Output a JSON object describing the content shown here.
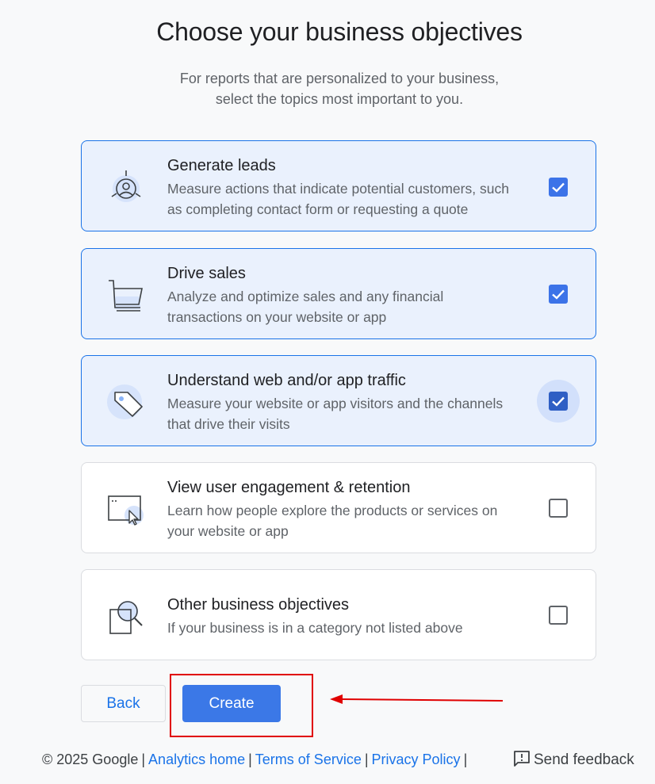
{
  "header": {
    "title": "Choose your business objectives",
    "subtitle_line1": "For reports that are personalized to your business,",
    "subtitle_line2": "select the topics most important to you."
  },
  "objectives": [
    {
      "title": "Generate leads",
      "desc_line1": "Measure actions that indicate potential customers, such",
      "desc_line2": "as completing contact form or requesting a quote",
      "checked": true,
      "icon": "lead-target-icon"
    },
    {
      "title": "Drive sales",
      "desc_line1": "Analyze and optimize sales and any financial",
      "desc_line2": "transactions on your website or app",
      "checked": true,
      "icon": "shopping-cart-icon"
    },
    {
      "title": "Understand web and/or app traffic",
      "desc_line1": "Measure your website or app visitors and the channels",
      "desc_line2": "that drive their visits",
      "checked": true,
      "icon": "tag-icon"
    },
    {
      "title": "View user engagement & retention",
      "desc_line1": "Learn how people explore the products or services on",
      "desc_line2": "your website or app",
      "checked": false,
      "icon": "browser-cursor-icon"
    },
    {
      "title": "Other business objectives",
      "desc_line1": "If your business is in a category not listed above",
      "checked": false,
      "icon": "magnifier-icon"
    }
  ],
  "actions": {
    "back_label": "Back",
    "create_label": "Create"
  },
  "footer": {
    "copyright": "© 2025 Google",
    "analytics_home": "Analytics home",
    "terms": "Terms of Service",
    "privacy": "Privacy Policy",
    "separator": "|",
    "send_feedback": "Send feedback"
  },
  "colors": {
    "accent": "#1a73e8",
    "selected_bg": "#eaf1fd",
    "annotation_red": "#e00000"
  }
}
